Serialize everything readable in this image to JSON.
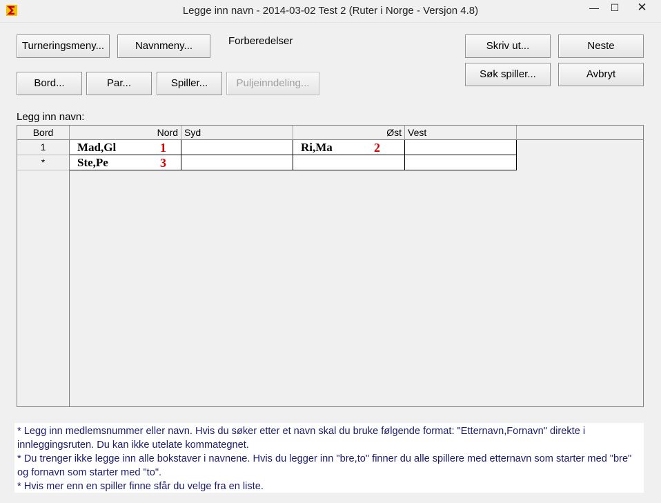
{
  "window": {
    "title": "Legge inn navn - 2014-03-02  Test 2  (Ruter i Norge - Versjon 4.8)",
    "min_glyph": "—",
    "max_glyph": "☐",
    "close_glyph": "✕"
  },
  "toolbar": {
    "turneringsmeny": "Turneringsmeny...",
    "navnmeny": "Navnmeny...",
    "forberedelser": "Forberedelser",
    "bord": "Bord...",
    "par": "Par...",
    "spiller": "Spiller...",
    "puljeinndeling": "Puljeinndeling...",
    "skriv_ut": "Skriv ut...",
    "neste": "Neste",
    "sok_spiller": "Søk spiller...",
    "avbryt": "Avbryt"
  },
  "grid": {
    "caption": "Legg inn navn:",
    "headers": {
      "bord": "Bord",
      "nord": "Nord",
      "syd": "Syd",
      "ost": "Øst",
      "vest": "Vest"
    },
    "rows": [
      {
        "bord": "1",
        "nord": "Mad,Gl",
        "nord_tag": "1",
        "syd": "",
        "ost": "Ri,Ma",
        "ost_tag": "2",
        "vest": ""
      },
      {
        "bord": "*",
        "nord": "Ste,Pe",
        "nord_tag": "3",
        "syd": "",
        "ost": "",
        "ost_tag": "",
        "vest": ""
      }
    ]
  },
  "help": [
    "* Legg inn medlemsnummer eller navn. Hvis du søker etter et navn skal du bruke følgende format: \"Etternavn,Fornavn\" direkte i innleggingsruten. Du kan ikke utelate kommategnet.",
    "* Du trenger ikke legge inn alle bokstaver i navnene. Hvis du legger inn \"bre,to\" finner du alle spillere med etternavn som starter med \"bre\" og fornavn som starter med \"to\".",
    "* Hvis mer enn en spiller finne sfår du velge fra en liste."
  ],
  "colors": {
    "tag_red": "#d00000",
    "help_text": "#1a1a6e"
  }
}
